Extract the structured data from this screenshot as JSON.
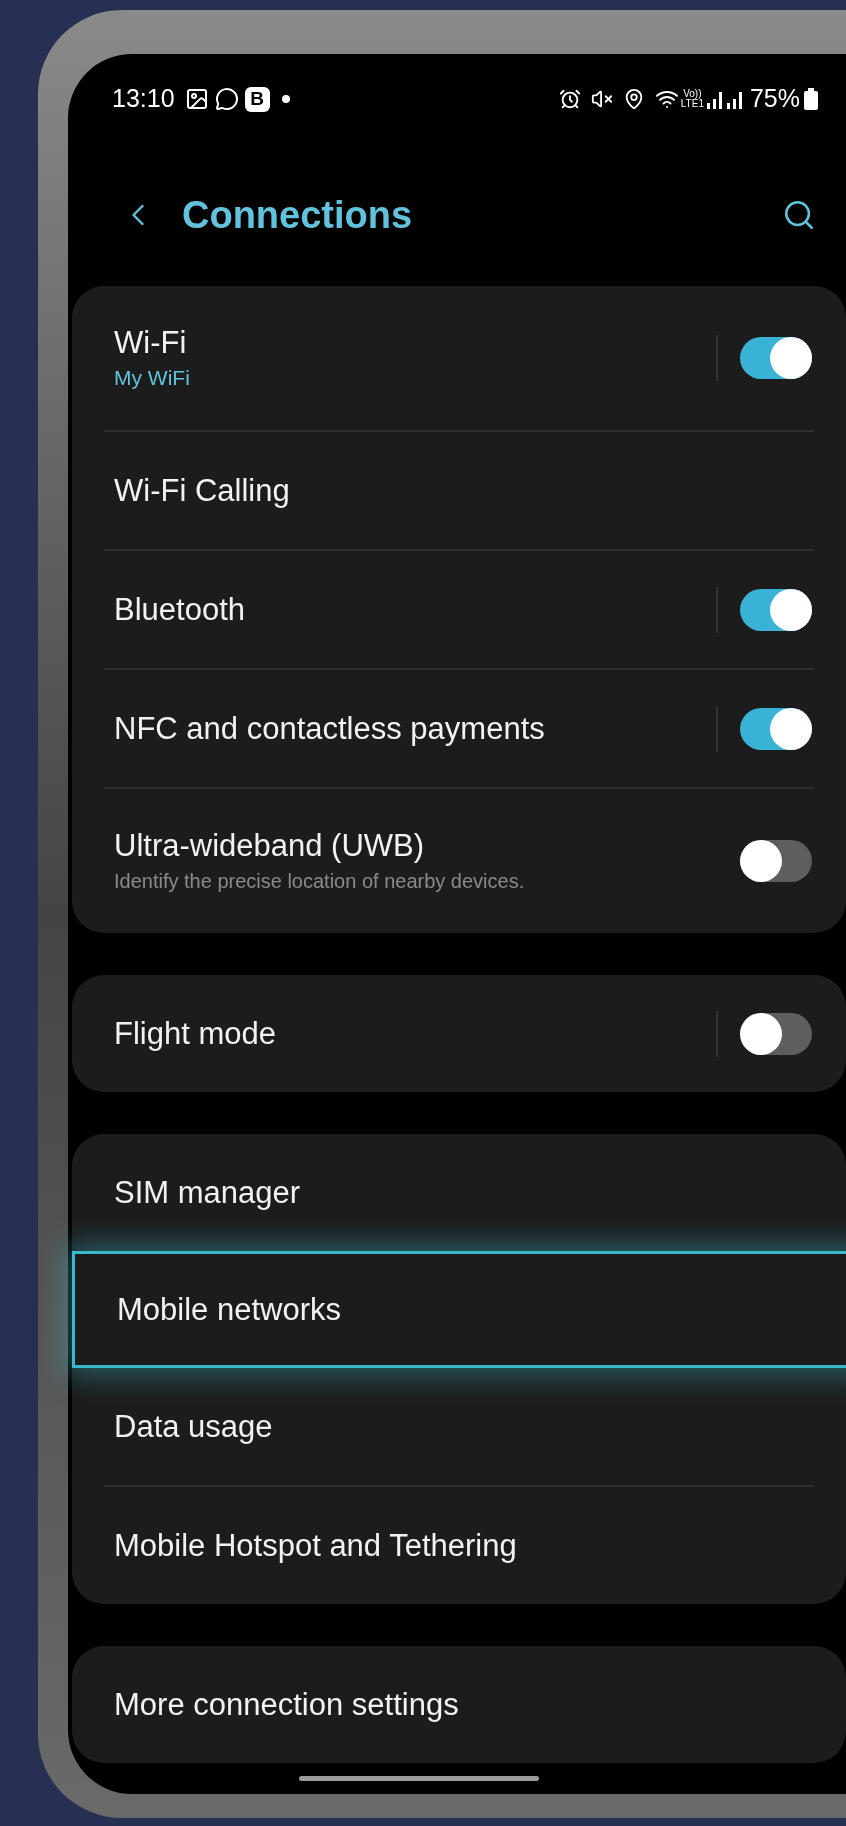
{
  "status_bar": {
    "time": "13:10",
    "app_badge": "B",
    "network_label_top": "Vo))",
    "network_label_bottom": "LTE1",
    "battery": "75%"
  },
  "header": {
    "title": "Connections"
  },
  "groups": [
    {
      "items": [
        {
          "kind": "toggle",
          "label": "Wi-Fi",
          "status": "My WiFi",
          "on": true,
          "selected": false
        },
        {
          "kind": "plain",
          "label": "Wi-Fi Calling",
          "selected": false
        },
        {
          "kind": "toggle",
          "label": "Bluetooth",
          "on": true,
          "selected": false
        },
        {
          "kind": "toggle",
          "label": "NFC and contactless payments",
          "on": true,
          "selected": false
        },
        {
          "kind": "toggle",
          "label": "Ultra-wideband (UWB)",
          "description": "Identify the precise location of nearby devices.",
          "on": false,
          "divider": false,
          "selected": false
        }
      ]
    },
    {
      "items": [
        {
          "kind": "toggle",
          "label": "Flight mode",
          "on": false,
          "selected": false
        }
      ]
    },
    {
      "items": [
        {
          "kind": "plain",
          "label": "SIM manager",
          "selected": false
        },
        {
          "kind": "plain",
          "label": "Mobile networks",
          "selected": true
        },
        {
          "kind": "plain",
          "label": "Data usage",
          "selected": false
        },
        {
          "kind": "plain",
          "label": "Mobile Hotspot and Tethering",
          "selected": false
        }
      ]
    },
    {
      "items": [
        {
          "kind": "plain",
          "label": "More connection settings",
          "selected": false
        }
      ]
    }
  ]
}
